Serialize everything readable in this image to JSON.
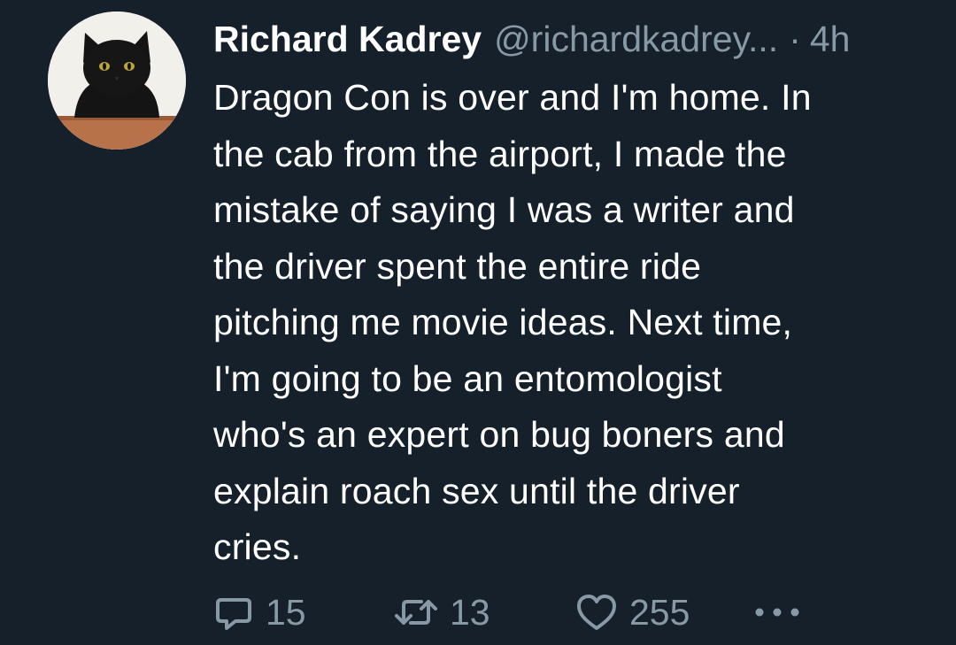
{
  "tweet": {
    "author": {
      "display_name": "Richard Kadrey",
      "handle": "@richardkadrey...",
      "avatar": "black-cat-avatar"
    },
    "separator": "·",
    "timestamp": "4h",
    "text": "Dragon Con is over and I'm home. In\nthe cab from the airport, I made the\nmistake of saying I was a writer and\nthe driver spent the entire ride\npitching me movie ideas. Next time,\nI'm going to be an entomologist\nwho's an expert on bug boners and\nexplain roach sex until the driver\ncries.",
    "actions": {
      "reply": {
        "icon": "reply-icon",
        "count": "15"
      },
      "retweet": {
        "icon": "retweet-icon",
        "count": "13"
      },
      "like": {
        "icon": "heart-icon",
        "count": "255"
      },
      "more": {
        "icon": "more-icon"
      }
    }
  },
  "colors": {
    "background": "#15202b",
    "primary_text": "#ffffff",
    "secondary_text": "#8899a6"
  }
}
